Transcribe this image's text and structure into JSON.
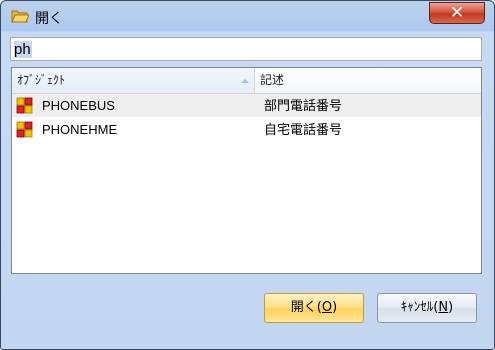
{
  "window": {
    "title": "開く",
    "close_symbol": "✕",
    "icon": "open-folder-icon"
  },
  "search": {
    "value": "ph",
    "placeholder": ""
  },
  "list": {
    "columns": [
      "ｵﾌﾞｼﾞｪｸﾄ",
      "記述"
    ],
    "sort_column": "ｵﾌﾞｼﾞｪｸﾄ",
    "sort_direction": "ascending",
    "rows": [
      {
        "object": "PHONEBUS",
        "description": "部門電話番号",
        "icon": "object-icon",
        "selected": true
      },
      {
        "object": "PHONEHME",
        "description": "自宅電話番号",
        "icon": "object-icon",
        "selected": false
      }
    ]
  },
  "buttons": {
    "open_label": "開く(",
    "open_key": "O",
    "open_end": ")",
    "cancel_label": "ｷｬﾝｾﾙ(",
    "cancel_key": "N",
    "cancel_end": ")"
  },
  "colors": {
    "window_bg": "#c3d6f0",
    "close_button": "#c4381e",
    "open_button": "#ffd35a",
    "selected_row": "#eeeeee"
  }
}
